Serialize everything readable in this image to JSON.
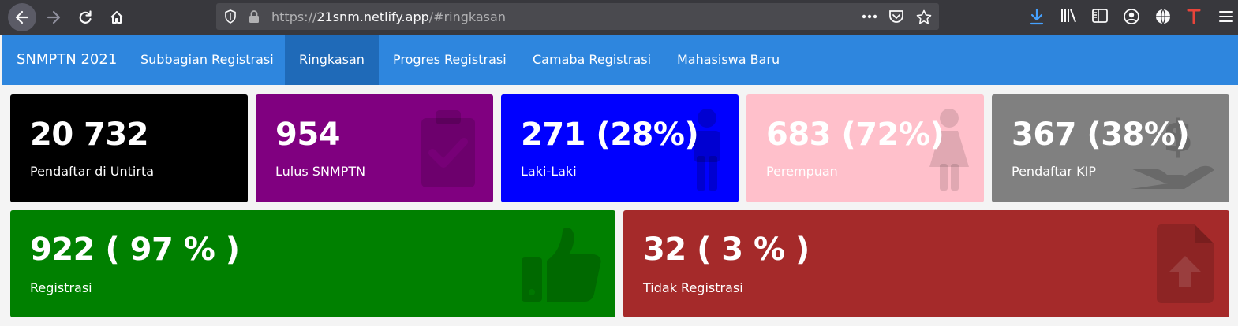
{
  "browser": {
    "url_host": "21snm.netlify.app",
    "url_prefix": "https://",
    "url_suffix": "/#ringkasan"
  },
  "navbar": {
    "brand": "SNMPTN 2021",
    "items": [
      {
        "label": "Subbagian Registrasi"
      },
      {
        "label": "Ringkasan",
        "active": true
      },
      {
        "label": "Progres Registrasi"
      },
      {
        "label": "Camaba Registrasi"
      },
      {
        "label": "Mahasiswa Baru"
      }
    ]
  },
  "cards": [
    {
      "value": "20 732",
      "label": "Pendaftar di Untirta",
      "color": "#000000",
      "icon": "none"
    },
    {
      "value": "954",
      "label": "Lulus SNMPTN",
      "color": "#800080",
      "icon": "clipboard-check-icon"
    },
    {
      "value": "271 (28%)",
      "label": "Laki-Laki",
      "color": "#0000ff",
      "icon": "male-icon"
    },
    {
      "value": "683 (72%)",
      "label": "Perempuan",
      "color": "#ffc0cb",
      "icon": "female-icon"
    },
    {
      "value": "367 (38%)",
      "label": "Pendaftar KIP",
      "color": "#808080",
      "icon": "hand-holding-dollar-icon"
    },
    {
      "value": "922 ( 97 % )",
      "label": "Registrasi",
      "color": "#008000",
      "icon": "thumbs-up-icon"
    },
    {
      "value": "32 ( 3 % )",
      "label": "Tidak Registrasi",
      "color": "#a52a2a",
      "icon": "file-upload-icon"
    }
  ]
}
